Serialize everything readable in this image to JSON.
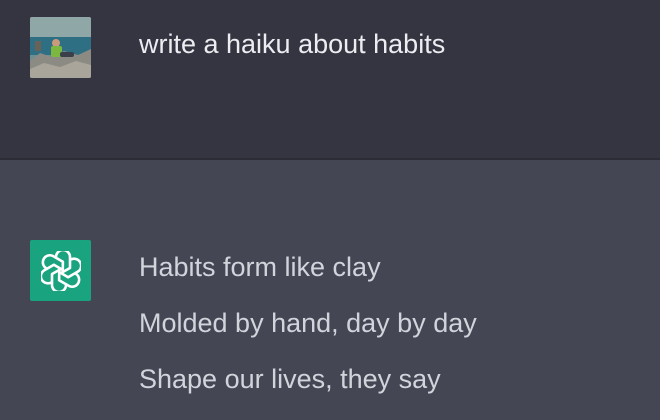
{
  "colors": {
    "user_row_bg": "#343541",
    "assistant_row_bg": "#444654",
    "bot_avatar_bg": "#19a37f",
    "user_text": "#ececf1",
    "assistant_text": "#d1d5db"
  },
  "user_message": {
    "avatar_icon": "user-photo-avatar",
    "text": "write a haiku about habits"
  },
  "assistant_message": {
    "avatar_icon": "openai-logo-icon",
    "lines": [
      "Habits form like clay",
      "Molded by hand, day by day",
      "Shape our lives, they say"
    ]
  }
}
